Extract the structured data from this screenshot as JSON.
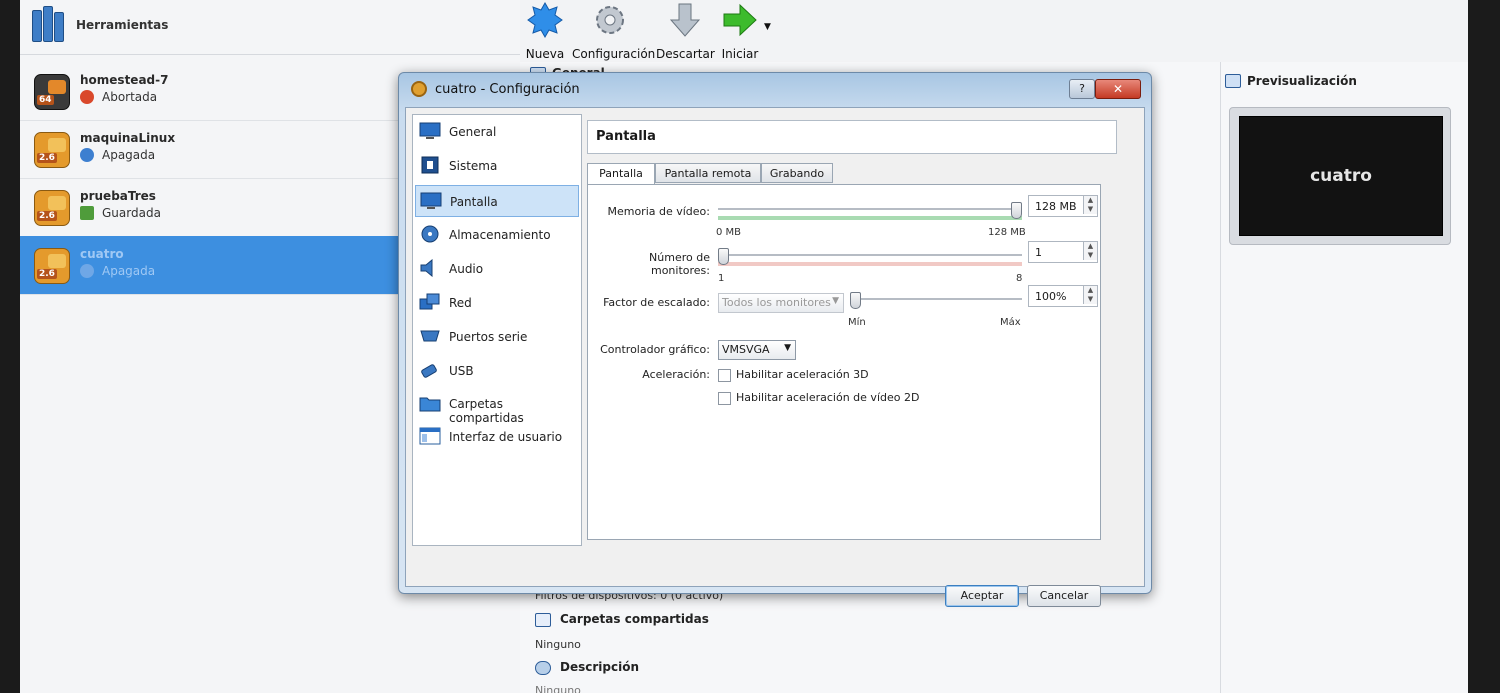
{
  "tools": {
    "label": "Herramientas"
  },
  "vms": [
    {
      "name": "homestead-7",
      "state": "Abortada",
      "version": "64",
      "state_color": "#d9482b"
    },
    {
      "name": "maquinaLinux",
      "state": "Apagada",
      "version": "2.6",
      "state_color": "#3d7fd0"
    },
    {
      "name": "pruebaTres",
      "state": "Guardada",
      "version": "2.6",
      "state_color": "#4f9c3b"
    },
    {
      "name": "cuatro",
      "state": "Apagada",
      "version": "2.6",
      "state_color": "#3d7fd0"
    }
  ],
  "toolbar": {
    "new": "Nueva",
    "settings": "Configuración",
    "discard": "Descartar",
    "start": "Iniciar"
  },
  "preview": {
    "title": "Previsualización",
    "vm_name": "cuatro"
  },
  "details": {
    "general_title": "General",
    "usb_filters": "Filtros de dispositivos:   0 (0 activo)",
    "shared_title": "Carpetas compartidas",
    "shared_value": "Ninguno",
    "desc_title": "Descripción",
    "desc_value": "Ninguno"
  },
  "dialog": {
    "title": "cuatro - Configuración",
    "help": "?",
    "close": "✕",
    "categories": [
      "General",
      "Sistema",
      "Pantalla",
      "Almacenamiento",
      "Audio",
      "Red",
      "Puertos serie",
      "USB",
      "Carpetas compartidas",
      "Interfaz de usuario"
    ],
    "active_category": "Pantalla",
    "panel_title": "Pantalla",
    "tabs": [
      "Pantalla",
      "Pantalla remota",
      "Grabando"
    ],
    "video_memory": {
      "label": "Memoria de vídeo:",
      "value": "128 MB",
      "min_label": "0 MB",
      "max_label": "128 MB",
      "level": 1.0
    },
    "monitors": {
      "label": "Número de monitores:",
      "value": "1",
      "min_label": "1",
      "max_label": "8",
      "level": 0.0
    },
    "scale": {
      "label": "Factor de escalado:",
      "combo": "Todos los monitores",
      "value": "100%",
      "min_label": "Mín",
      "max_label": "Máx",
      "level": 0.0
    },
    "controller": {
      "label": "Controlador gráfico:",
      "value": "VMSVGA"
    },
    "acceleration": {
      "label": "Aceleración:",
      "opt3d": "Habilitar aceleración 3D",
      "opt2d": "Habilitar aceleración de vídeo 2D"
    },
    "ok": "Aceptar",
    "cancel": "Cancelar"
  }
}
